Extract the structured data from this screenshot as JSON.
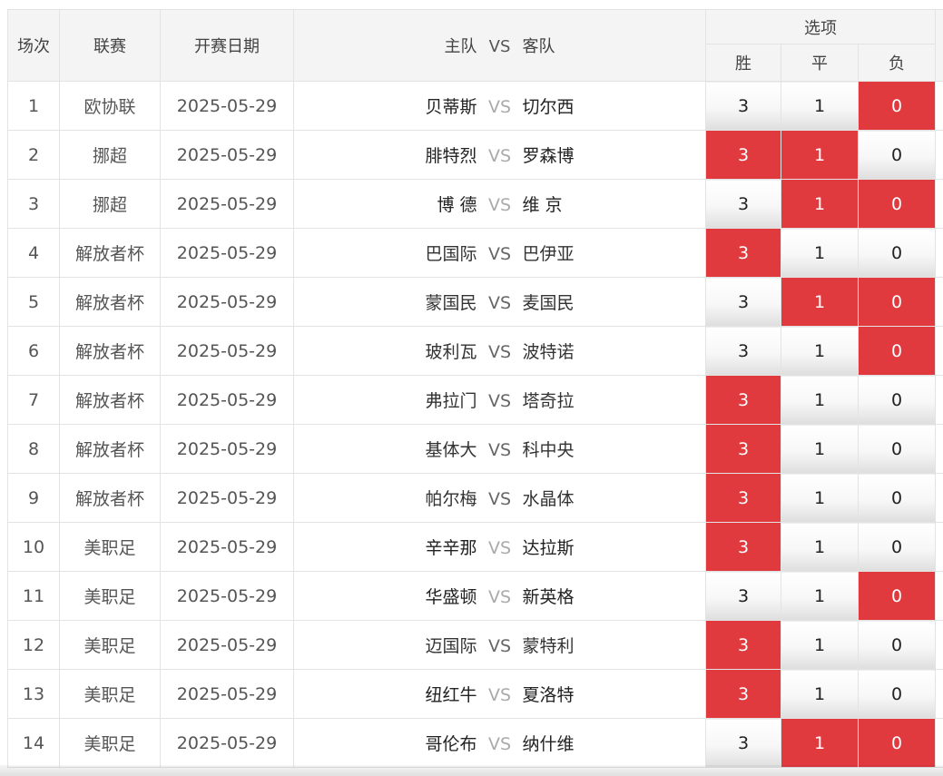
{
  "header": {
    "num": "场次",
    "league": "联赛",
    "date": "开赛日期",
    "home": "主队",
    "vs": "VS",
    "away": "客队",
    "options": "选项",
    "win": "胜",
    "draw": "平",
    "lose": "负"
  },
  "options_values": {
    "win": "3",
    "draw": "1",
    "lose": "0"
  },
  "colors": {
    "selected": "#e0393e",
    "header_bg": "#f4f4f4"
  },
  "matches": [
    {
      "num": "1",
      "league": "欧协联",
      "date": "2025-05-29",
      "home": "贝蒂斯",
      "vs": "VS",
      "away": "切尔西",
      "dim": false,
      "win": "3",
      "draw": "1",
      "lose": "0",
      "sel": [
        false,
        false,
        true
      ]
    },
    {
      "num": "2",
      "league": "挪超",
      "date": "2025-05-29",
      "home": "腓特烈",
      "vs": "VS",
      "away": "罗森博",
      "dim": false,
      "win": "3",
      "draw": "1",
      "lose": "0",
      "sel": [
        true,
        true,
        false
      ]
    },
    {
      "num": "3",
      "league": "挪超",
      "date": "2025-05-29",
      "home": "博 德",
      "vs": "VS",
      "away": "维 京",
      "dim": false,
      "win": "3",
      "draw": "1",
      "lose": "0",
      "sel": [
        false,
        true,
        true
      ]
    },
    {
      "num": "4",
      "league": "解放者杯",
      "date": "2025-05-29",
      "home": "巴国际",
      "vs": "VS",
      "away": "巴伊亚",
      "dim": true,
      "win": "3",
      "draw": "1",
      "lose": "0",
      "sel": [
        true,
        false,
        false
      ]
    },
    {
      "num": "5",
      "league": "解放者杯",
      "date": "2025-05-29",
      "home": "蒙国民",
      "vs": "VS",
      "away": "麦国民",
      "dim": true,
      "win": "3",
      "draw": "1",
      "lose": "0",
      "sel": [
        false,
        true,
        true
      ]
    },
    {
      "num": "6",
      "league": "解放者杯",
      "date": "2025-05-29",
      "home": "玻利瓦",
      "vs": "VS",
      "away": "波特诺",
      "dim": true,
      "win": "3",
      "draw": "1",
      "lose": "0",
      "sel": [
        false,
        false,
        true
      ]
    },
    {
      "num": "7",
      "league": "解放者杯",
      "date": "2025-05-29",
      "home": "弗拉门",
      "vs": "VS",
      "away": "塔奇拉",
      "dim": true,
      "win": "3",
      "draw": "1",
      "lose": "0",
      "sel": [
        true,
        false,
        false
      ]
    },
    {
      "num": "8",
      "league": "解放者杯",
      "date": "2025-05-29",
      "home": "基体大",
      "vs": "VS",
      "away": "科中央",
      "dim": true,
      "win": "3",
      "draw": "1",
      "lose": "0",
      "sel": [
        true,
        false,
        false
      ]
    },
    {
      "num": "9",
      "league": "解放者杯",
      "date": "2025-05-29",
      "home": "帕尔梅",
      "vs": "VS",
      "away": "水晶体",
      "dim": true,
      "win": "3",
      "draw": "1",
      "lose": "0",
      "sel": [
        true,
        false,
        false
      ]
    },
    {
      "num": "10",
      "league": "美职足",
      "date": "2025-05-29",
      "home": "辛辛那",
      "vs": "VS",
      "away": "达拉斯",
      "dim": false,
      "win": "3",
      "draw": "1",
      "lose": "0",
      "sel": [
        true,
        false,
        false
      ]
    },
    {
      "num": "11",
      "league": "美职足",
      "date": "2025-05-29",
      "home": "华盛顿",
      "vs": "VS",
      "away": "新英格",
      "dim": false,
      "win": "3",
      "draw": "1",
      "lose": "0",
      "sel": [
        false,
        false,
        true
      ]
    },
    {
      "num": "12",
      "league": "美职足",
      "date": "2025-05-29",
      "home": "迈国际",
      "vs": "VS",
      "away": "蒙特利",
      "dim": true,
      "win": "3",
      "draw": "1",
      "lose": "0",
      "sel": [
        true,
        false,
        false
      ]
    },
    {
      "num": "13",
      "league": "美职足",
      "date": "2025-05-29",
      "home": "纽红牛",
      "vs": "VS",
      "away": "夏洛特",
      "dim": false,
      "win": "3",
      "draw": "1",
      "lose": "0",
      "sel": [
        true,
        false,
        false
      ]
    },
    {
      "num": "14",
      "league": "美职足",
      "date": "2025-05-29",
      "home": "哥伦布",
      "vs": "VS",
      "away": "纳什维",
      "dim": false,
      "win": "3",
      "draw": "1",
      "lose": "0",
      "sel": [
        false,
        true,
        true
      ]
    }
  ]
}
